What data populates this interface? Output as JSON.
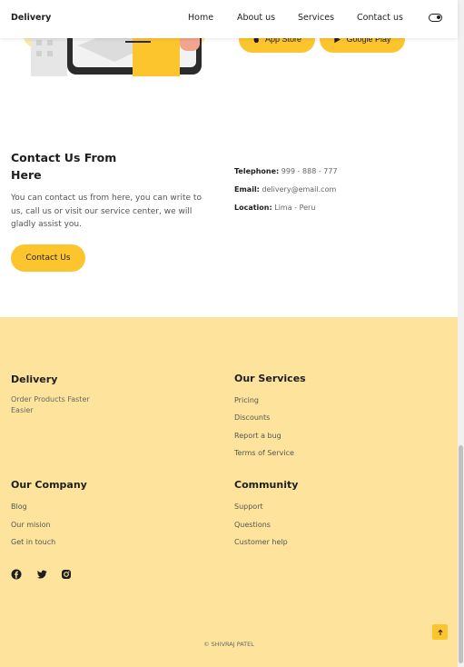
{
  "header": {
    "logo": "Delivery",
    "nav": [
      "Home",
      "About us",
      "Services",
      "Contact us"
    ],
    "theme_toggle_icon": "theme-toggle-icon"
  },
  "hero": {
    "app_store_label": "App Store",
    "google_play_label": "Google Play"
  },
  "contact": {
    "title": "Contact Us From Here",
    "description": "You can contact us from here, you can write to us, call us or visit our service center, we will gladly assist you.",
    "button_label": "Contact Us",
    "telephone_label": "Telephone:",
    "telephone_value": "999 - 888 - 777",
    "email_label": "Email:",
    "email_value": "delivery@email.com",
    "location_label": "Location:",
    "location_value": "Lima - Peru"
  },
  "footer": {
    "brand_title": "Delivery",
    "brand_text": "Order Products Faster Easier",
    "services_title": "Our Services",
    "services": [
      "Pricing",
      "Discounts",
      "Report a bug",
      "Terms of Service"
    ],
    "company_title": "Our Company",
    "company": [
      "Blog",
      "Our mision",
      "Get in touch"
    ],
    "community_title": "Community",
    "community": [
      "Support",
      "Questions",
      "Customer help"
    ],
    "social_icons": [
      "facebook-icon",
      "twitter-icon",
      "instagram-icon"
    ],
    "copyright": "© SHIVRAJ PATEL"
  },
  "colors": {
    "accent": "#fdc52d",
    "footer_bg": "#fde39b",
    "text_dark": "#1e1e1e"
  }
}
